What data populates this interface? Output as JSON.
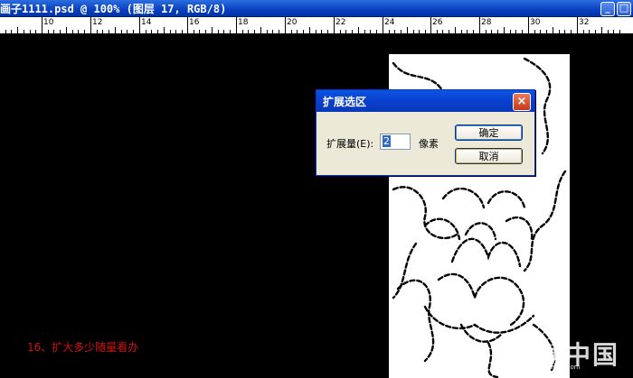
{
  "titlebar": {
    "title": "画子1111.psd @ 100% (图层 17, RGB/8)",
    "minimize_glyph": "_",
    "restore_glyph": "□"
  },
  "ruler": {
    "labels": [
      "10",
      "12",
      "14",
      "16",
      "18",
      "20",
      "22",
      "24",
      "26",
      "28",
      "30",
      "32"
    ]
  },
  "dialog": {
    "title": "扩展选区",
    "close_glyph": "×",
    "amount_label": "扩展量(E):",
    "amount_value": "2",
    "unit": "像素",
    "ok_label": "确定",
    "cancel_label": "取消"
  },
  "caption": "16、扩大多少随量看办",
  "watermark": {
    "text": "爱动中国",
    "sub": "bbs.16xx8.com"
  },
  "colors": {
    "titlebar": "#0a3fbf",
    "dialog_bg": "#ece9d8",
    "caption": "#d21010"
  }
}
